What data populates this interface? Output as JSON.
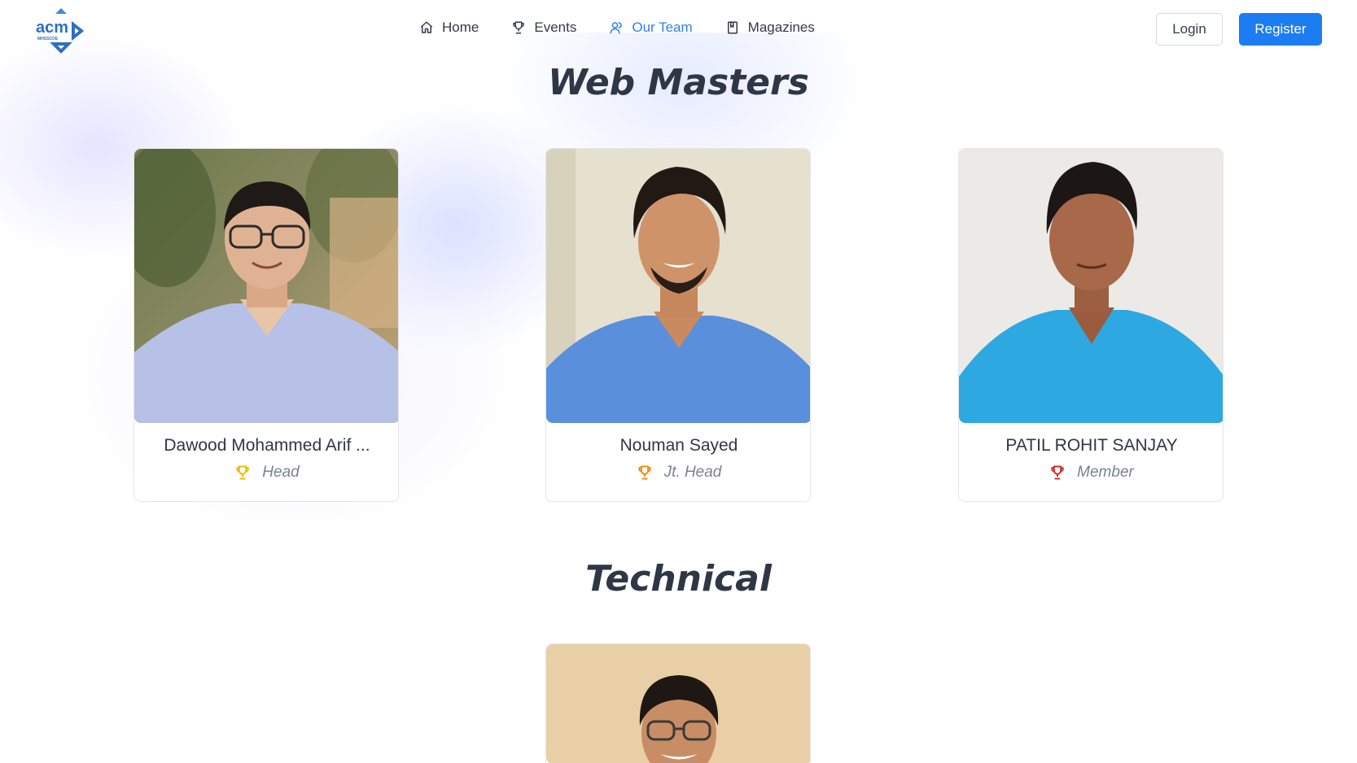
{
  "nav": {
    "logo_text": "acm",
    "logo_subtext": "MHSSCOE",
    "items": [
      {
        "label": "Home",
        "icon": "home-icon",
        "active": false
      },
      {
        "label": "Events",
        "icon": "trophy-icon",
        "active": false
      },
      {
        "label": "Our Team",
        "icon": "team-icon",
        "active": true
      },
      {
        "label": "Magazines",
        "icon": "book-icon",
        "active": false
      }
    ],
    "login_label": "Login",
    "register_label": "Register"
  },
  "colors": {
    "accent": "#1c7cf2",
    "active_link": "#2f7ff0",
    "trophy_gold": "#f2b705",
    "trophy_orange": "#ef8d12",
    "trophy_red": "#d02c2c"
  },
  "sections": [
    {
      "title": "Web Masters",
      "members": [
        {
          "name": "Dawood Mohammed Arif ...",
          "role": "Head",
          "trophy_color": "gold"
        },
        {
          "name": "Nouman Sayed",
          "role": "Jt. Head",
          "trophy_color": "orange"
        },
        {
          "name": "PATIL ROHIT SANJAY",
          "role": "Member",
          "trophy_color": "red"
        }
      ]
    },
    {
      "title": "Technical",
      "members": []
    }
  ]
}
